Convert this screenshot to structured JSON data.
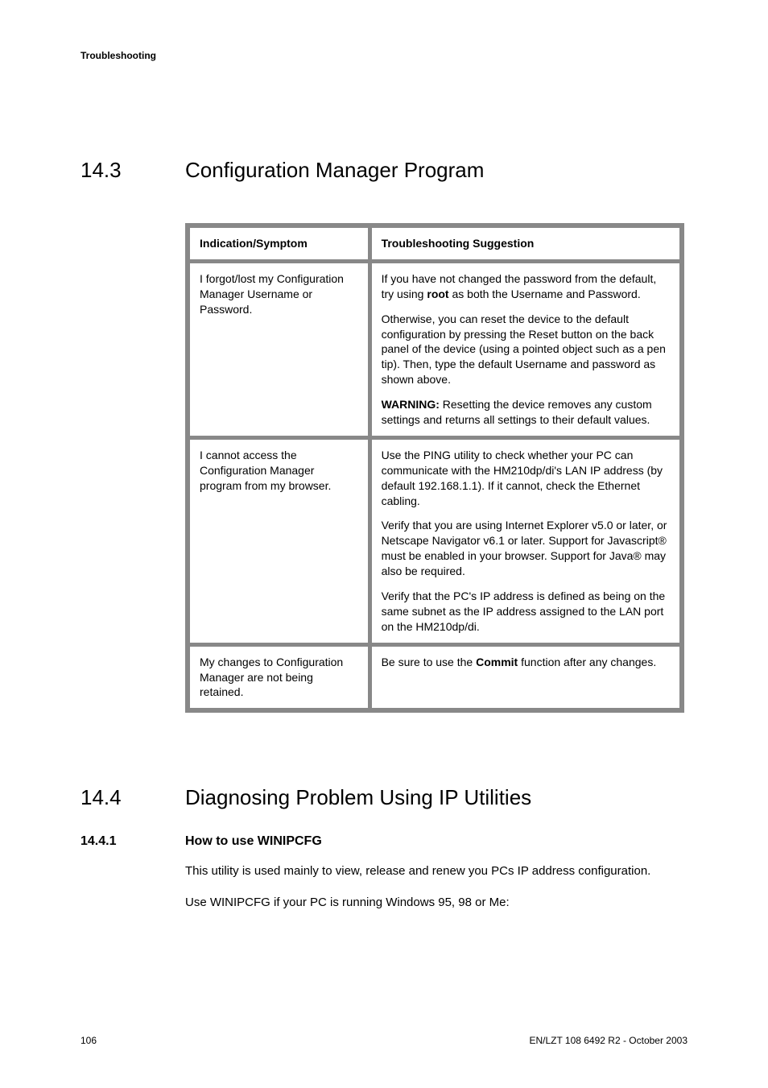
{
  "running_head": "Troubleshooting",
  "section1": {
    "number": "14.3",
    "title": "Configuration Manager Program",
    "table": {
      "headers": {
        "symptom": "Indication/Symptom",
        "suggestion": "Troubleshooting Suggestion"
      },
      "rows": [
        {
          "symptom": "I forgot/lost my Configuration Manager Username or Password.",
          "suggestion_p1_pre": "If you have not changed the password from the default, try using ",
          "suggestion_p1_bold": "root",
          "suggestion_p1_post": " as both the Username and Password.",
          "suggestion_p2": "Otherwise, you can reset the device to the default configuration by pressing the Reset button on the back panel of the device (using a pointed object such as a pen tip). Then, type the default Username and password as shown above.",
          "suggestion_p3_bold": "WARNING:",
          "suggestion_p3_rest": " Resetting the device removes any custom settings and returns all settings to their default values."
        },
        {
          "symptom": "I cannot access the Configuration Manager program from my browser.",
          "suggestion_p1": "Use the PING utility to check whether your PC can communicate with the HM210dp/di's LAN IP address (by default 192.168.1.1). If it cannot, check the Ethernet cabling.",
          "suggestion_p2": "Verify that you are using Internet Explorer v5.0 or later, or Netscape Navigator v6.1 or later. Support for Javascript® must be enabled in your browser. Support for Java® may also be required.",
          "suggestion_p3": "Verify that the PC's IP address is defined as being on the same subnet as the IP address assigned to the LAN port on the HM210dp/di."
        },
        {
          "symptom": "My changes to Configuration Manager are not being retained.",
          "suggestion_p1_pre": "Be sure to use the ",
          "suggestion_p1_bold": "Commit",
          "suggestion_p1_post": " function after any changes."
        }
      ]
    }
  },
  "section2": {
    "number": "14.4",
    "title": "Diagnosing Problem Using IP Utilities",
    "sub": {
      "number": "14.4.1",
      "title": "How to use WINIPCFG",
      "p1": "This utility is used mainly to view, release and renew you PCs IP address configuration.",
      "p2": "Use WINIPCFG if your PC is running Windows 95, 98 or Me:"
    }
  },
  "footer": {
    "page": "106",
    "docid": "EN/LZT 108 6492 R2  - October 2003"
  }
}
